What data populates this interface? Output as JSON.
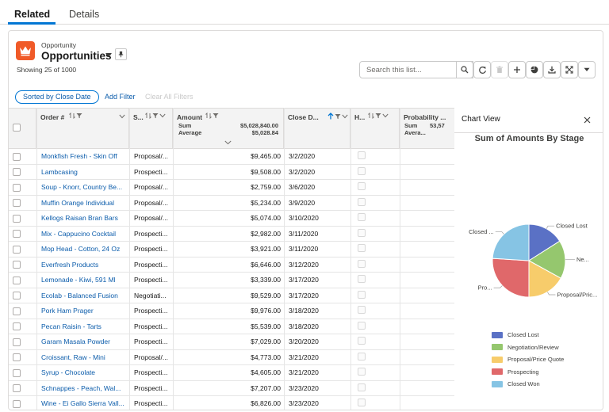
{
  "tabs": [
    {
      "label": "Related",
      "active": true
    },
    {
      "label": "Details",
      "active": false
    }
  ],
  "header": {
    "object_label": "Opportunity",
    "title": "Opportunities",
    "showing": "Showing 25 of 1000",
    "icon": "crown-icon"
  },
  "toolbar": {
    "search_placeholder": "Search this list...",
    "buttons": [
      "search-icon",
      "refresh-icon",
      "delete-icon",
      "add-icon",
      "chart-icon",
      "download-icon",
      "expand-icon",
      "chevron-down-icon"
    ]
  },
  "filters": {
    "sorted_by": "Sorted by Close Date",
    "add_filter": "Add Filter",
    "clear_all": "Clear All Filters"
  },
  "columns": {
    "order": "Order #",
    "stage": "S...",
    "amount": "Amount",
    "close_date": "Close D...",
    "h": "H...",
    "probability": "Probability ..."
  },
  "aggregates": {
    "amount_sum_label": "Sum",
    "amount_sum": "$5,028,840.00",
    "amount_avg_label": "Average",
    "amount_avg": "$5,028.84",
    "prob_sum_label": "Sum",
    "prob_sum": "53,57",
    "prob_avg_label": "Avera..."
  },
  "rows": [
    {
      "order": "Monkfish Fresh - Skin Off",
      "stage": "Proposal/...",
      "amount": "$9,465.00",
      "close": "3/2/2020"
    },
    {
      "order": "Lambcasing",
      "stage": "Prospecti...",
      "amount": "$9,508.00",
      "close": "3/2/2020"
    },
    {
      "order": "Soup - Knorr, Country Be...",
      "stage": "Proposal/...",
      "amount": "$2,759.00",
      "close": "3/6/2020"
    },
    {
      "order": "Muffin Orange Individual",
      "stage": "Proposal/...",
      "amount": "$5,234.00",
      "close": "3/9/2020"
    },
    {
      "order": "Kellogs Raisan Bran Bars",
      "stage": "Proposal/...",
      "amount": "$5,074.00",
      "close": "3/10/2020"
    },
    {
      "order": "Mix - Cappucino Cocktail",
      "stage": "Prospecti...",
      "amount": "$2,982.00",
      "close": "3/11/2020"
    },
    {
      "order": "Mop Head - Cotton, 24 Oz",
      "stage": "Prospecti...",
      "amount": "$3,921.00",
      "close": "3/11/2020"
    },
    {
      "order": "Everfresh Products",
      "stage": "Prospecti...",
      "amount": "$6,646.00",
      "close": "3/12/2020"
    },
    {
      "order": "Lemonade - Kiwi, 591 Ml",
      "stage": "Prospecti...",
      "amount": "$3,339.00",
      "close": "3/17/2020"
    },
    {
      "order": "Ecolab - Balanced Fusion",
      "stage": "Negotiati...",
      "amount": "$9,529.00",
      "close": "3/17/2020"
    },
    {
      "order": "Pork Ham Prager",
      "stage": "Prospecti...",
      "amount": "$9,976.00",
      "close": "3/18/2020"
    },
    {
      "order": "Pecan Raisin - Tarts",
      "stage": "Prospecti...",
      "amount": "$5,539.00",
      "close": "3/18/2020"
    },
    {
      "order": "Garam Masala Powder",
      "stage": "Prospecti...",
      "amount": "$7,029.00",
      "close": "3/20/2020"
    },
    {
      "order": "Croissant, Raw - Mini",
      "stage": "Proposal/...",
      "amount": "$4,773.00",
      "close": "3/21/2020"
    },
    {
      "order": "Syrup - Chocolate",
      "stage": "Prospecti...",
      "amount": "$4,605.00",
      "close": "3/21/2020"
    },
    {
      "order": "Schnappes - Peach, Wal...",
      "stage": "Prospecti...",
      "amount": "$7,207.00",
      "close": "3/23/2020"
    },
    {
      "order": "Wine - Ei Gallo Sierra Vall...",
      "stage": "Prospecti...",
      "amount": "$6,826.00",
      "close": "3/23/2020"
    }
  ],
  "chart_panel": {
    "header": "Chart View",
    "title": "Sum of Amounts By Stage"
  },
  "chart_data": {
    "type": "pie",
    "title": "Sum of Amounts By Stage",
    "legend_position": "bottom",
    "slices": [
      {
        "label": "Closed Lost",
        "callout": "Closed Lost",
        "value": 0.16,
        "color": "#5a71c5"
      },
      {
        "label": "Negotiation/Review",
        "callout": "Ne...",
        "value": 0.17,
        "color": "#95c76e"
      },
      {
        "label": "Proposal/Price Quote",
        "callout": "Proposal/Pric...",
        "value": 0.17,
        "color": "#f7cc6b"
      },
      {
        "label": "Prospecting",
        "callout": "Pro...",
        "value": 0.26,
        "color": "#e0686a"
      },
      {
        "label": "Closed Won",
        "callout": "Closed ...",
        "value": 0.24,
        "color": "#86c4e4"
      }
    ]
  }
}
